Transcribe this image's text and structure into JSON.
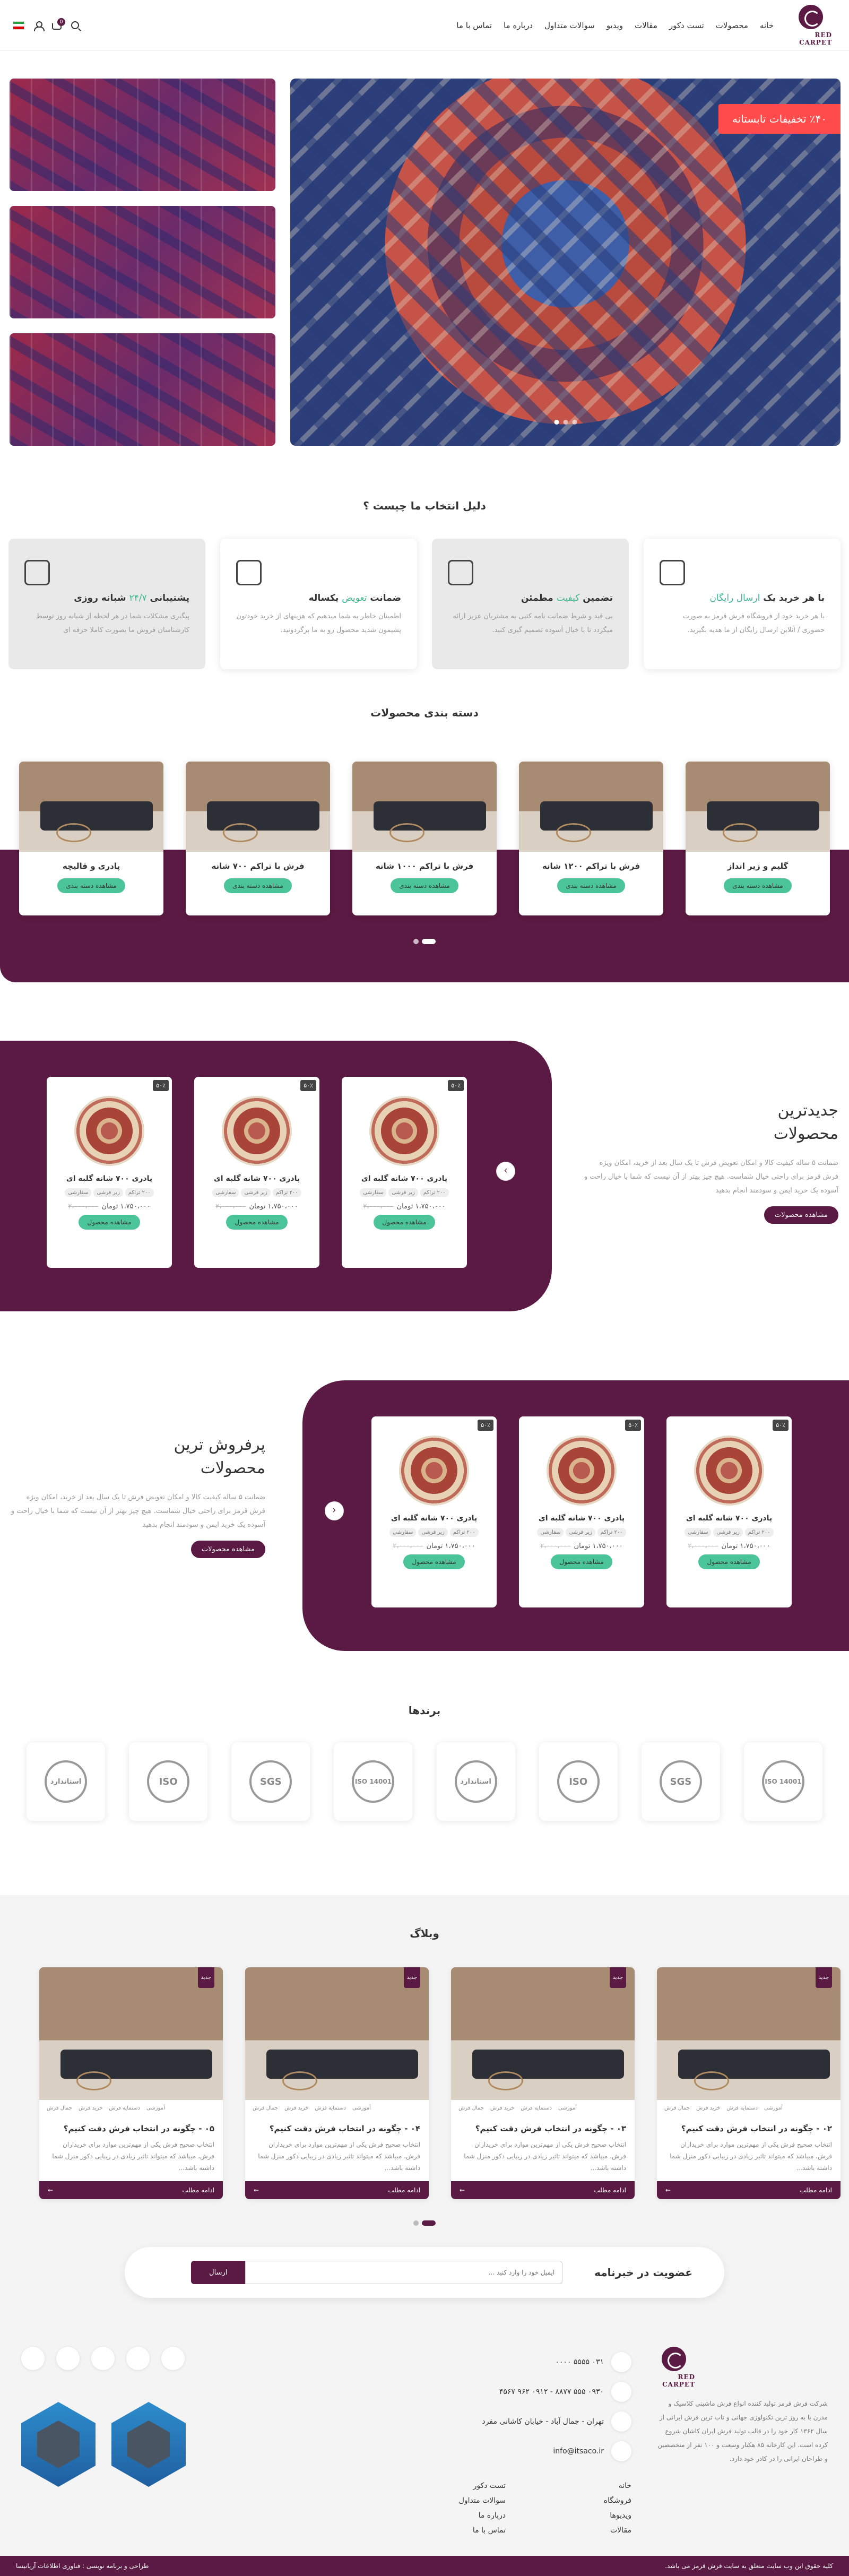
{
  "header": {
    "logo_text": "RED CARPET",
    "nav": [
      "خانه",
      "محصولات",
      "تست دکور",
      "مقالات",
      "ویدیو",
      "سوالات متداول",
      "درباره ما",
      "تماس با ما"
    ],
    "cart_count": "0"
  },
  "hero": {
    "discount": "٪۴۰ تخفیفات تابستانه"
  },
  "why": {
    "title": "دلیل انتخاب ما چیست ؟",
    "cards": [
      {
        "title_pre": "با هر خرید یک",
        "title_hl": "ارسال رایگان",
        "title_post": "",
        "text": "با هر خرید خود از فروشگاه فرش قرمز به صورت حضوری / آنلاین ارسال رایگان از ما هدیه بگیرید."
      },
      {
        "title_pre": "تضمین",
        "title_hl": "کیفیت",
        "title_post": "مطمئن",
        "text": "بی قید و شرط ضمانت نامه کتبی به مشتریان عزیز ارائه میگردد تا با خیال آسوده تصمیم گیری کنید."
      },
      {
        "title_pre": "ضمانت",
        "title_hl": "تعویض",
        "title_post": "یکساله",
        "text": "اطمینان خاطر به شما میدهیم که هزینهای از خرید خودتون پشیمون شدید محصول رو به ما برگردونید."
      },
      {
        "title_pre": "پشتیبانی",
        "title_hl": "۲۴/۷",
        "title_post": "شبانه روزی",
        "text": "پیگیری مشکلات شما در هر لحظه از شبانه روز توسط کارشناسان فروش ما بصورت کاملا حرفه ای"
      }
    ]
  },
  "categories": {
    "title": "دسته بندی محصولات",
    "button": "مشاهده دسته بندی",
    "items": [
      "گلیم و زیر انداز",
      "فرش با تراکم ۱۲۰۰ شانه",
      "فرش با تراکم ۱۰۰۰ شانه",
      "فرش با تراکم ۷۰۰ شانه",
      "پادری و قالیچه"
    ]
  },
  "newest": {
    "title_line1": "جدیدترین",
    "title_line2": "محصولات",
    "text": "ضمانت ۵ ساله کیفیت کالا و امکان تعویض فرش تا یک سال بعد از خرید، امکان ویژه فرش قرمز برای راحتی خیال شماست. هیچ چیز بهتر از آن نیست که شما با خیال راحت و آسوده یک خرید ایمن و سودمند انجام بدهید",
    "button": "مشاهده محصولات"
  },
  "bestsellers": {
    "title_line1": "پرفروش ترین",
    "title_line2": "محصولات",
    "text": "ضمانت ۵ ساله کیفیت کالا و امکان تعویض فرش تا یک سال بعد از خرید، امکان ویژه فرش قرمز برای راحتی خیال شماست. هیچ چیز بهتر از آن نیست که شما با خیال راحت و آسوده یک خرید ایمن و سودمند انجام بدهید",
    "button": "مشاهده محصولات"
  },
  "product": {
    "discount": "۵۰٪",
    "name": "پادری ۷۰۰ شانه گلبه ای",
    "tags": [
      "۲۰۰ تراکم",
      "زیر فرشی",
      "سفارشی"
    ],
    "price": "۱،۷۵۰،۰۰۰ تومان",
    "old_price": "۲،۰۰۰،۰۰۰",
    "button": "مشاهده محصول"
  },
  "brands": {
    "title": "برندها",
    "items": [
      "ISO 14001",
      "SGS",
      "ISO",
      "استاندارد",
      "ISO 14001",
      "SGS",
      "ISO",
      "استاندارد"
    ]
  },
  "blog": {
    "title": "وبلاگ",
    "new_tag": "جدید",
    "tags": [
      "آموزشی",
      "دستمایه فرش",
      "خرید فرش",
      "جمال فرش"
    ],
    "text": "انتخاب صحیح فرش یکی از مهم‌ترین موارد برای خریداران فرش، میباشد که میتواند تاثیر زیادی در زیبایی دکور منزل شما داشته باشد...",
    "more": "ادامه مطلب",
    "posts": [
      "۰۲ - چگونه در انتخاب فرش دقت کنیم؟",
      "۰۳ - چگونه در انتخاب فرش دقت کنیم؟",
      "۰۴ - چگونه در انتخاب فرش دقت کنیم؟",
      "۰۵ - چگونه در انتخاب فرش دقت کنیم؟"
    ]
  },
  "newsletter": {
    "title": "عضویت در خبرنامه",
    "placeholder": "ایمیل خود را وارد کنید ...",
    "button": "ارسال"
  },
  "footer": {
    "logo_text": "RED CARPET",
    "about": "شرکت فرش قرمز تولید کننده انواع فرش ماشینی کلاسیک و مدرن با به روز ترین تکنولوژی جهانی و تاب ترین فرش ایرانی از سال ۱۳۶۲ کار خود را در قالب تولید فرش ایران کاشان شروع کرده است. این کارخانه ۸۵ هکتار وسعت و ۱۰۰ نفر از متخصصین و طراحان ایرانی را در کادر خود دارد.",
    "phone": "۰۳۱ ۵۵۵۵ ۰۰۰۰",
    "mobile": "۰۹۳۰ ۵۵۵ ۸۸۷۷ - ۰۹۱۲ ۹۶۲ ۴۵۶۷",
    "address": "تهران - جمال آباد - خیابان کاشانی مفرد",
    "email": "info@itsaco.ir",
    "links": [
      "خانه",
      "تست دکور",
      "فروشگاه",
      "سوالات متداول",
      "ویدیوها",
      "درباره ما",
      "مقالات",
      "تماس با ما"
    ]
  },
  "copyright": {
    "left": "طراحی و برنامه نویسی : فناوری اطلاعات آریانیسا",
    "right": "کلیه حقوق این وب سایت متعلق به سایت فرش قرمز می باشد."
  }
}
